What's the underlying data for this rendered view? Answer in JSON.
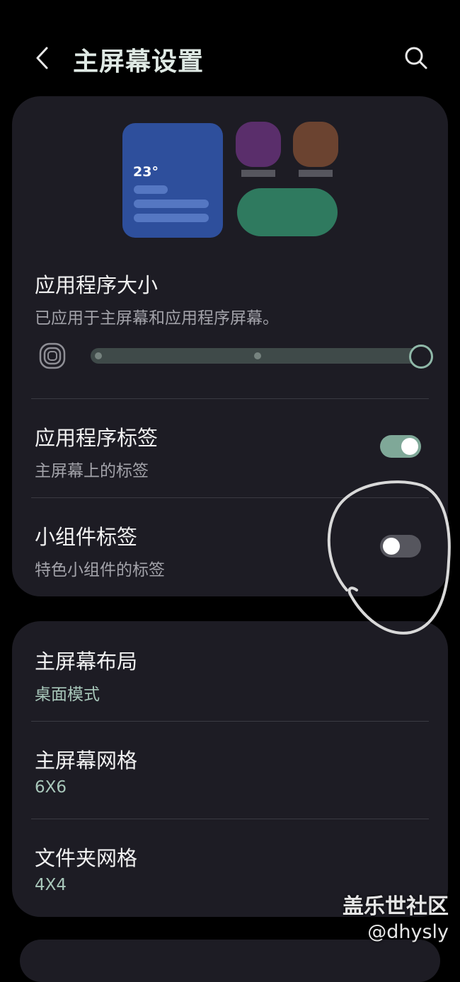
{
  "header": {
    "title": "主屏幕设置",
    "back_icon": "chevron-left-icon",
    "search_icon": "search-icon"
  },
  "preview": {
    "weather_temp": "23°",
    "colors": {
      "weather": "#2e4f9c",
      "purple_icon": "#5a2e6b",
      "brown_icon": "#6b4330",
      "pill": "#2f7a5f"
    }
  },
  "app_size": {
    "title": "应用程序大小",
    "subtitle": "已应用于主屏幕和应用程序屏幕。",
    "slider_steps": 3,
    "slider_selected": 3
  },
  "app_labels": {
    "title": "应用程序标签",
    "subtitle": "主屏幕上的标签",
    "enabled": true
  },
  "widget_labels": {
    "title": "小组件标签",
    "subtitle": "特色小组件的标签",
    "enabled": false
  },
  "layout": {
    "title": "主屏幕布局",
    "value": "桌面模式"
  },
  "home_grid": {
    "title": "主屏幕网格",
    "value": "6X6"
  },
  "folder_grid": {
    "title": "文件夹网格",
    "value": "4X4"
  },
  "watermark": {
    "line1": "盖乐世社区",
    "line2": "@dhysly"
  },
  "colors": {
    "background": "#000000",
    "card": "#1d1c24",
    "accent": "#7fa898",
    "title": "#dfe9e4"
  }
}
